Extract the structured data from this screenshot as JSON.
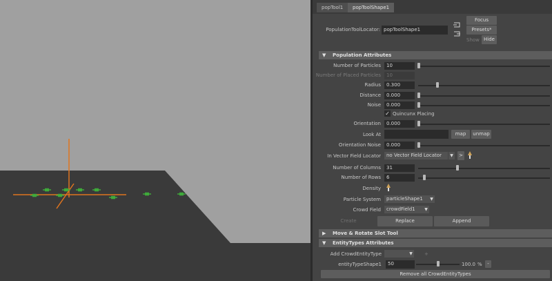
{
  "tabs": [
    {
      "label": "popTool1"
    },
    {
      "label": "popToolShape1"
    }
  ],
  "locator": {
    "label": "PopulationToolLocator:",
    "value": "popToolShape1",
    "focus_label": "Focus",
    "presets_label": "Presets*",
    "show_label": "Show",
    "hide_label": "Hide"
  },
  "population": {
    "title": "Population Attributes",
    "num_particles": {
      "label": "Number of Particles",
      "value": "10",
      "level": 0.0
    },
    "num_placed": {
      "label": "Number of Placed Particles",
      "value": "10"
    },
    "radius": {
      "label": "Radius",
      "value": "0.300",
      "level": 0.15
    },
    "distance": {
      "label": "Distance",
      "value": "0.000",
      "level": 0.0
    },
    "noise": {
      "label": "Noise",
      "value": "0.000",
      "level": 0.0
    },
    "quincunx": {
      "label": "Quincunx Placing",
      "checked": true
    },
    "orientation": {
      "label": "Orientation",
      "value": "0.000",
      "level": 0.0
    },
    "look_at": {
      "label": "Look At",
      "value": "",
      "map_label": "map",
      "unmap_label": "unmap"
    },
    "orientation_noise": {
      "label": "Orientation Noise",
      "value": "0.000",
      "level": 0.0
    },
    "vector_field": {
      "label": "In Vector Field Locator",
      "value": "no Vector Field Locator",
      "more_label": ">"
    },
    "num_columns": {
      "label": "Number of Columns",
      "value": "31",
      "level": 0.3
    },
    "num_rows": {
      "label": "Number of Rows",
      "value": "6",
      "level": 0.05
    },
    "density": {
      "label": "Density"
    },
    "particle_system": {
      "label": "Particle System",
      "value": "particleShape1"
    },
    "crowd_field": {
      "label": "Crowd Field",
      "value": "crowdField1"
    },
    "create_label": "Create",
    "replace_label": "Replace",
    "append_label": "Append"
  },
  "move_rotate": {
    "title": "Move & Rotate Slot Tool"
  },
  "entity_types": {
    "title": "EntityTypes Attributes",
    "add_label": "Add CrowdEntityType",
    "add_value": "",
    "add_plus": "+",
    "shape_label": "entityTypeShape1",
    "shape_value": "50",
    "shape_level": 0.5,
    "percent_value": "100.0",
    "percent_unit": "%",
    "minus_label": "-",
    "remove_label": "Remove all CrowdEntityTypes"
  },
  "colors": {
    "viewport_bg": "#a0a0a0",
    "ground": "#3a3a3a",
    "locator_orange": "#e0741e",
    "particle_green": "#3faa3a",
    "panel_bg": "#444444",
    "section_bg": "#5d5d5d"
  },
  "icons": {
    "select_in": "arrow-in-icon",
    "select_out": "arrow-out-icon",
    "density_map": "paint-brush-icon",
    "vector_field_picker": "paint-brush-icon"
  }
}
